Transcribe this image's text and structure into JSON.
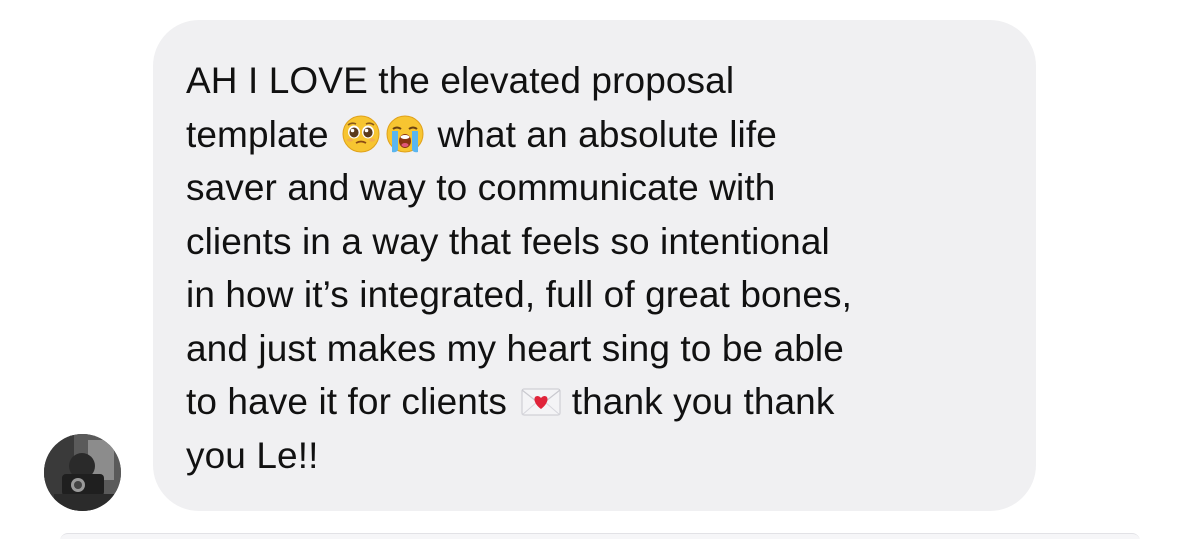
{
  "message": {
    "line1": "AH I LOVE the elevated proposal",
    "line2_before": "template ",
    "line2_after": " what an absolute life",
    "line3": "saver and way to communicate with",
    "line4": "clients in a way that feels so intentional",
    "line5": "in how it’s integrated, full of great bones,",
    "line6": "and just makes my heart sing to be able",
    "line7_before": "to have it for clients ",
    "line7_after": " thank you thank",
    "line8": "you Le!!",
    "emojis": [
      "pleading-face-emoji",
      "loudly-crying-face-emoji",
      "love-letter-emoji"
    ]
  },
  "colors": {
    "bubble": "#f0f0f2",
    "text": "#111111",
    "background": "#ffffff"
  }
}
